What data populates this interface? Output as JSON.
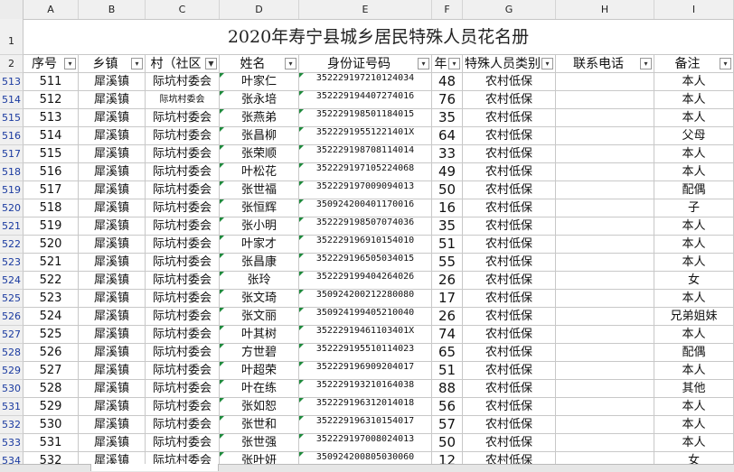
{
  "columns": [
    "A",
    "B",
    "C",
    "D",
    "E",
    "F",
    "G",
    "H",
    "I"
  ],
  "title": "2020年寿宁县城乡居民特殊人员花名册",
  "headers": [
    "序号",
    "乡镇",
    "村（社区",
    "姓名",
    "身份证号码",
    "年",
    "特殊人员类别",
    "联系电话",
    "备注"
  ],
  "header_row_nums": [
    "1",
    "2"
  ],
  "rows": [
    {
      "r": "513",
      "seq": "511",
      "town": "犀溪镇",
      "village": "际坑村委会",
      "name": "叶家仁",
      "id": "352229197210124034",
      "age": "48",
      "type": "农村低保",
      "phone": "",
      "note": "本人"
    },
    {
      "r": "514",
      "seq": "512",
      "town": "犀溪镇",
      "village": "际坑村委会",
      "name": "张永培",
      "id": "352229194407274016",
      "age": "76",
      "type": "农村低保",
      "phone": "",
      "note": "本人"
    },
    {
      "r": "515",
      "seq": "513",
      "town": "犀溪镇",
      "village": "际坑村委会",
      "name": "张燕弟",
      "id": "352229198501184015",
      "age": "35",
      "type": "农村低保",
      "phone": "",
      "note": "本人"
    },
    {
      "r": "516",
      "seq": "514",
      "town": "犀溪镇",
      "village": "际坑村委会",
      "name": "张昌柳",
      "id": "35222919551221401X",
      "age": "64",
      "type": "农村低保",
      "phone": "",
      "note": "父母"
    },
    {
      "r": "517",
      "seq": "515",
      "town": "犀溪镇",
      "village": "际坑村委会",
      "name": "张荣顺",
      "id": "352229198708114014",
      "age": "33",
      "type": "农村低保",
      "phone": "",
      "note": "本人"
    },
    {
      "r": "518",
      "seq": "516",
      "town": "犀溪镇",
      "village": "际坑村委会",
      "name": "叶松花",
      "id": "352229197105224068",
      "age": "49",
      "type": "农村低保",
      "phone": "",
      "note": "本人"
    },
    {
      "r": "519",
      "seq": "517",
      "town": "犀溪镇",
      "village": "际坑村委会",
      "name": "张世福",
      "id": "352229197009094013",
      "age": "50",
      "type": "农村低保",
      "phone": "",
      "note": "配偶"
    },
    {
      "r": "520",
      "seq": "518",
      "town": "犀溪镇",
      "village": "际坑村委会",
      "name": "张恒辉",
      "id": "350924200401170016",
      "age": "16",
      "type": "农村低保",
      "phone": "",
      "note": "子"
    },
    {
      "r": "521",
      "seq": "519",
      "town": "犀溪镇",
      "village": "际坑村委会",
      "name": "张小明",
      "id": "352229198507074036",
      "age": "35",
      "type": "农村低保",
      "phone": "",
      "note": "本人"
    },
    {
      "r": "522",
      "seq": "520",
      "town": "犀溪镇",
      "village": "际坑村委会",
      "name": "叶家才",
      "id": "352229196910154010",
      "age": "51",
      "type": "农村低保",
      "phone": "",
      "note": "本人"
    },
    {
      "r": "523",
      "seq": "521",
      "town": "犀溪镇",
      "village": "际坑村委会",
      "name": "张昌康",
      "id": "352229196505034015",
      "age": "55",
      "type": "农村低保",
      "phone": "",
      "note": "本人"
    },
    {
      "r": "524",
      "seq": "522",
      "town": "犀溪镇",
      "village": "际坑村委会",
      "name": "张玲",
      "id": "352229199404264026",
      "age": "26",
      "type": "农村低保",
      "phone": "",
      "note": "女"
    },
    {
      "r": "525",
      "seq": "523",
      "town": "犀溪镇",
      "village": "际坑村委会",
      "name": "张文琦",
      "id": "350924200212280080",
      "age": "17",
      "type": "农村低保",
      "phone": "",
      "note": "本人"
    },
    {
      "r": "526",
      "seq": "524",
      "town": "犀溪镇",
      "village": "际坑村委会",
      "name": "张文丽",
      "id": "350924199405210040",
      "age": "26",
      "type": "农村低保",
      "phone": "",
      "note": "兄弟姐妹"
    },
    {
      "r": "527",
      "seq": "525",
      "town": "犀溪镇",
      "village": "际坑村委会",
      "name": "叶其树",
      "id": "35222919461103401X",
      "age": "74",
      "type": "农村低保",
      "phone": "",
      "note": "本人"
    },
    {
      "r": "528",
      "seq": "526",
      "town": "犀溪镇",
      "village": "际坑村委会",
      "name": "方世碧",
      "id": "352229195510114023",
      "age": "65",
      "type": "农村低保",
      "phone": "",
      "note": "配偶"
    },
    {
      "r": "529",
      "seq": "527",
      "town": "犀溪镇",
      "village": "际坑村委会",
      "name": "叶超荣",
      "id": "352229196909204017",
      "age": "51",
      "type": "农村低保",
      "phone": "",
      "note": "本人"
    },
    {
      "r": "530",
      "seq": "528",
      "town": "犀溪镇",
      "village": "际坑村委会",
      "name": "叶在练",
      "id": "352229193210164038",
      "age": "88",
      "type": "农村低保",
      "phone": "",
      "note": "其他"
    },
    {
      "r": "531",
      "seq": "529",
      "town": "犀溪镇",
      "village": "际坑村委会",
      "name": "张如恕",
      "id": "352229196312014018",
      "age": "56",
      "type": "农村低保",
      "phone": "",
      "note": "本人"
    },
    {
      "r": "532",
      "seq": "530",
      "town": "犀溪镇",
      "village": "际坑村委会",
      "name": "张世和",
      "id": "352229196310154017",
      "age": "57",
      "type": "农村低保",
      "phone": "",
      "note": "本人"
    },
    {
      "r": "533",
      "seq": "531",
      "town": "犀溪镇",
      "village": "际坑村委会",
      "name": "张世强",
      "id": "352229197008024013",
      "age": "50",
      "type": "农村低保",
      "phone": "",
      "note": "本人"
    },
    {
      "r": "534",
      "seq": "532",
      "town": "犀溪镇",
      "village": "际坑村委会",
      "name": "张叶妍",
      "id": "350924200805030060",
      "age": "12",
      "type": "农村低保",
      "phone": "",
      "note": "女"
    }
  ]
}
